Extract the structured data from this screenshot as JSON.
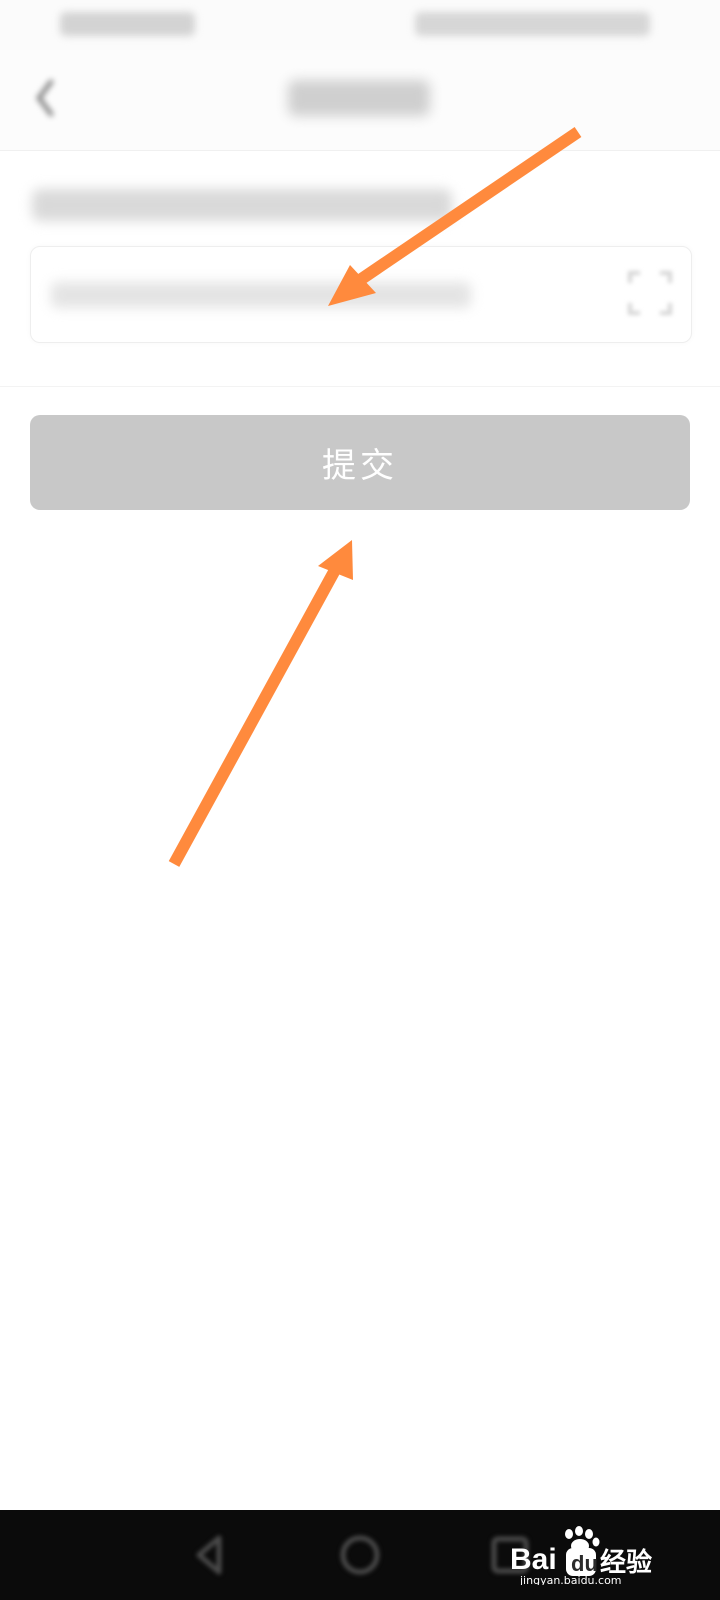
{
  "submit": {
    "label": "提交",
    "background": "#c8c8c8",
    "text_color": "#ffffff"
  },
  "annotation_color": "#ff8a3d",
  "icons": {
    "back": "back-chevron-icon",
    "scan": "scan-icon",
    "nav_back": "nav-back-icon",
    "nav_home": "nav-home-icon",
    "nav_recent": "nav-recent-icon"
  },
  "watermark": {
    "logo_text": "Bai du 经验",
    "url": "jingyan.baidu.com"
  }
}
